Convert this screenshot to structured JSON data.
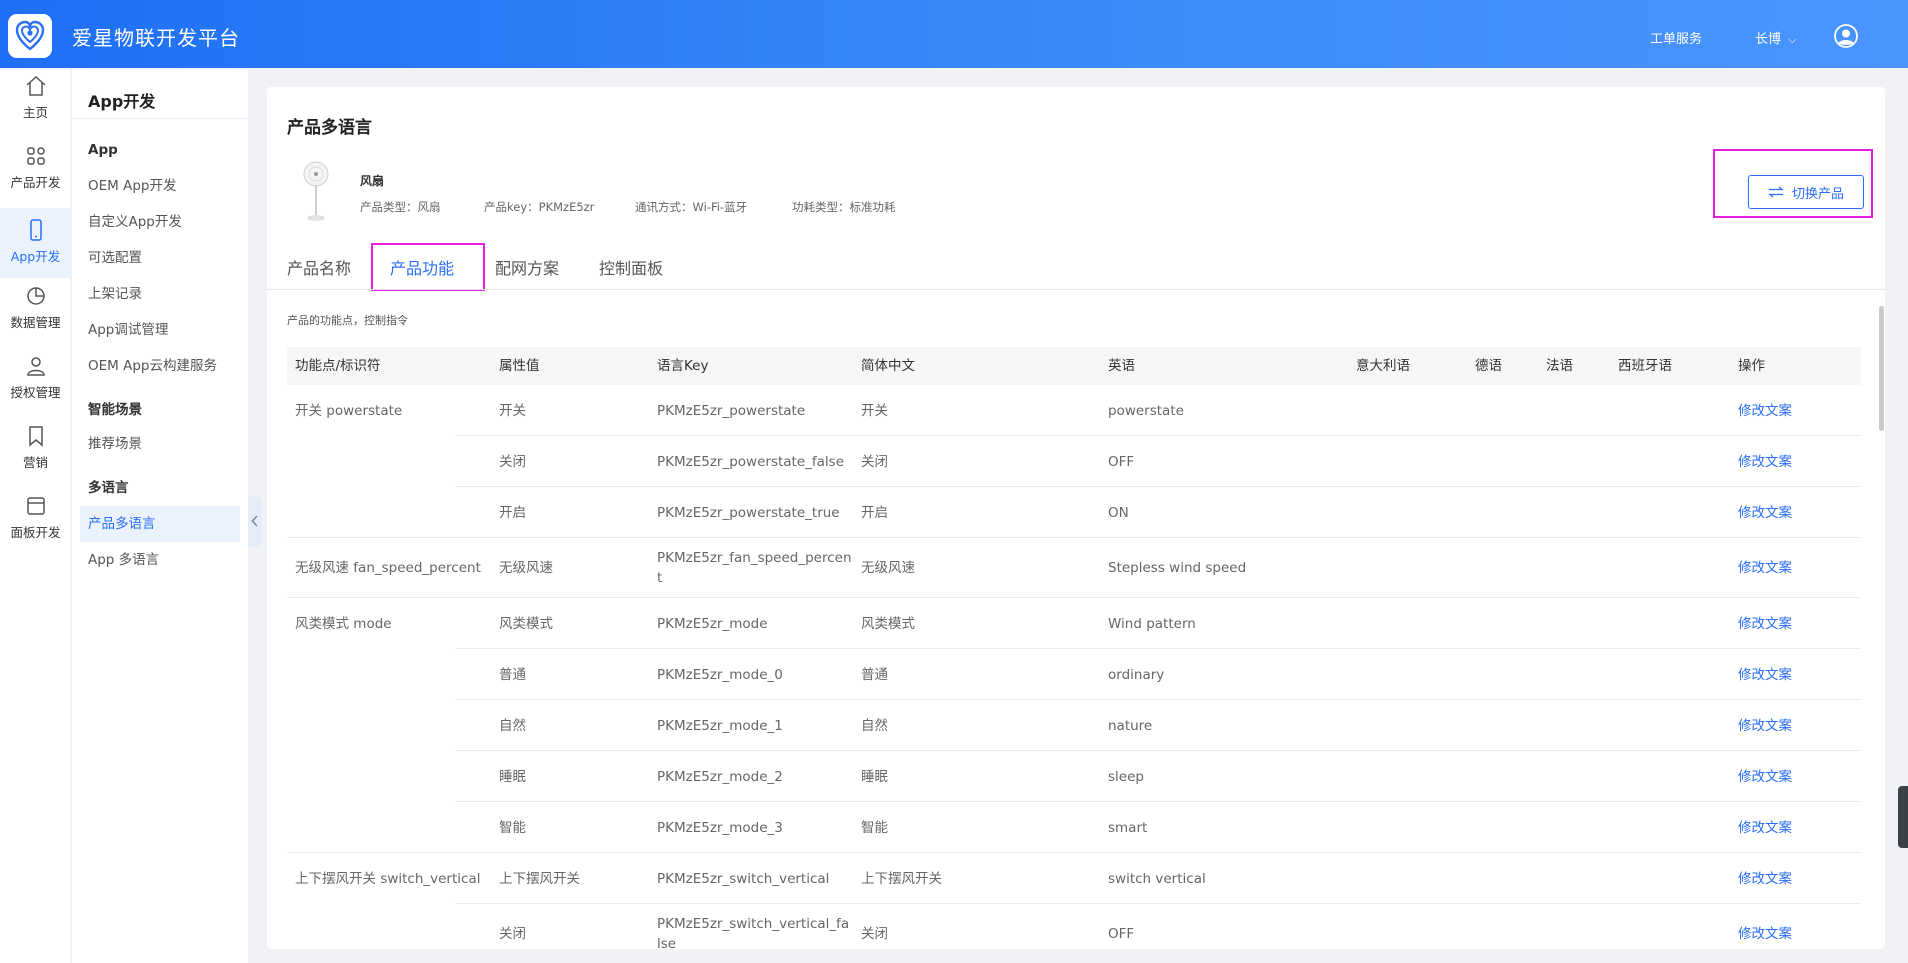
{
  "header": {
    "title": "爱星物联开发平台",
    "service": "工单服务",
    "user": "长博",
    "user_chevron": "⌵"
  },
  "rail": [
    {
      "label": "主页",
      "icon": "home-icon"
    },
    {
      "label": "产品开发",
      "icon": "grid-icon"
    },
    {
      "label": "App开发",
      "icon": "phone-icon",
      "active": true
    },
    {
      "label": "数据管理",
      "icon": "pie-chart-icon"
    },
    {
      "label": "授权管理",
      "icon": "user-icon"
    },
    {
      "label": "营销",
      "icon": "bookmark-icon"
    },
    {
      "label": "面板开发",
      "icon": "panel-icon"
    }
  ],
  "sidebar": {
    "title": "App开发",
    "group_app": "App",
    "items_app": [
      "OEM App开发",
      "自定义App开发",
      "可选配置",
      "上架记录",
      "App调试管理",
      "OEM App云构建服务"
    ],
    "group_scene": "智能场景",
    "items_scene": [
      "推荐场景"
    ],
    "group_lang": "多语言",
    "items_lang": [
      "产品多语言",
      "App 多语言"
    ]
  },
  "page": {
    "title": "产品多语言",
    "product_name": "风扇",
    "meta": [
      "产品类型：风扇",
      "产品key：PKMzE5zr",
      "通讯方式：Wi-Fi-蓝牙",
      "功耗类型：标准功耗"
    ],
    "switch_label": "切换产品",
    "tabs": [
      "产品名称",
      "产品功能",
      "配网方案",
      "控制面板"
    ],
    "active_tab": 1,
    "description": "产品的功能点，控制指令"
  },
  "table": {
    "columns": [
      "功能点/标识符",
      "属性值",
      "语言Key",
      "简体中文",
      "英语",
      "意大利语",
      "德语",
      "法语",
      "西班牙语",
      "操作"
    ],
    "rows": [
      {
        "feature": "开关 powerstate",
        "attr": "开关",
        "key": "PKMzE5zr_powerstate",
        "zh": "开关",
        "en": "powerstate",
        "op": "修改文案"
      },
      {
        "feature": "",
        "attr": "关闭",
        "key": "PKMzE5zr_powerstate_false",
        "zh": "关闭",
        "en": "OFF",
        "op": "修改文案"
      },
      {
        "feature": "",
        "attr": "开启",
        "key": "PKMzE5zr_powerstate_true",
        "zh": "开启",
        "en": "ON",
        "op": "修改文案"
      },
      {
        "feature": "无级风速 fan_speed_percent",
        "attr": "无级风速",
        "key": "PKMzE5zr_fan_speed_percent",
        "zh": "无级风速",
        "en": "Stepless wind speed",
        "op": "修改文案"
      },
      {
        "feature": "风类模式 mode",
        "attr": "风类模式",
        "key": "PKMzE5zr_mode",
        "zh": "风类模式",
        "en": "Wind pattern",
        "op": "修改文案"
      },
      {
        "feature": "",
        "attr": "普通",
        "key": "PKMzE5zr_mode_0",
        "zh": "普通",
        "en": "ordinary",
        "op": "修改文案"
      },
      {
        "feature": "",
        "attr": "自然",
        "key": "PKMzE5zr_mode_1",
        "zh": "自然",
        "en": "nature",
        "op": "修改文案"
      },
      {
        "feature": "",
        "attr": "睡眠",
        "key": "PKMzE5zr_mode_2",
        "zh": "睡眠",
        "en": "sleep",
        "op": "修改文案"
      },
      {
        "feature": "",
        "attr": "智能",
        "key": "PKMzE5zr_mode_3",
        "zh": "智能",
        "en": "smart",
        "op": "修改文案"
      },
      {
        "feature": "上下摆风开关 switch_vertical",
        "attr": "上下摆风开关",
        "key": "PKMzE5zr_switch_vertical",
        "zh": "上下摆风开关",
        "en": "switch vertical",
        "op": "修改文案"
      },
      {
        "feature": "",
        "attr": "关闭",
        "key": "PKMzE5zr_switch_vertical_false",
        "zh": "关闭",
        "en": "OFF",
        "op": "修改文案"
      }
    ]
  },
  "colors": {
    "primary": "#2b6ef7",
    "highlight": "#e11fe0",
    "header_start": "#1f6ff5",
    "header_end": "#4a95fc"
  }
}
